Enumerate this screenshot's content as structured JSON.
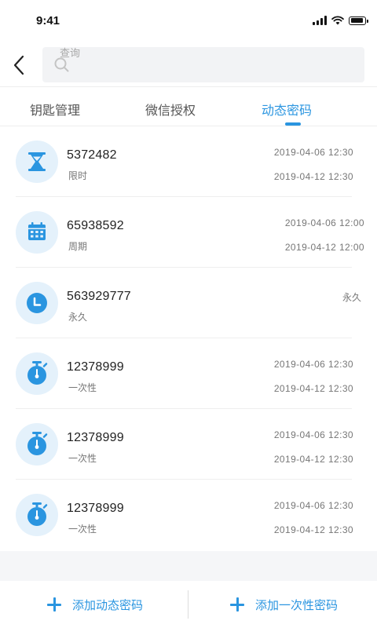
{
  "status_bar": {
    "time": "9:41"
  },
  "search": {
    "placeholder": "查询"
  },
  "tabs": [
    {
      "label": "钥匙管理",
      "active": false
    },
    {
      "label": "微信授权",
      "active": false
    },
    {
      "label": "动态密码",
      "active": true
    }
  ],
  "passwords": [
    {
      "code": "5372482",
      "type": "限时",
      "icon": "hourglass-icon",
      "start": "2019-04-06 12:30",
      "end": "2019-04-12 12:30"
    },
    {
      "code": "65938592",
      "type": "周期",
      "icon": "calendar-icon",
      "start": "2019-04-06 12:00",
      "end": "2019-04-12 12:00"
    },
    {
      "code": "563929777",
      "type": "永久",
      "icon": "clock-icon",
      "validity": "永久"
    },
    {
      "code": "12378999",
      "type": "一次性",
      "icon": "stopwatch-icon",
      "start": "2019-04-06 12:30",
      "end": "2019-04-12 12:30"
    },
    {
      "code": "12378999",
      "type": "一次性",
      "icon": "stopwatch-icon",
      "start": "2019-04-06 12:30",
      "end": "2019-04-12 12:30"
    },
    {
      "code": "12378999",
      "type": "一次性",
      "icon": "stopwatch-icon",
      "start": "2019-04-06 12:30",
      "end": "2019-04-12 12:30"
    }
  ],
  "actions": {
    "add_dynamic_label": "添加动态密码",
    "add_onetime_label": "添加一次性密码"
  },
  "colors": {
    "accent": "#2a95e0",
    "icon_bg": "#e4f1fb"
  }
}
